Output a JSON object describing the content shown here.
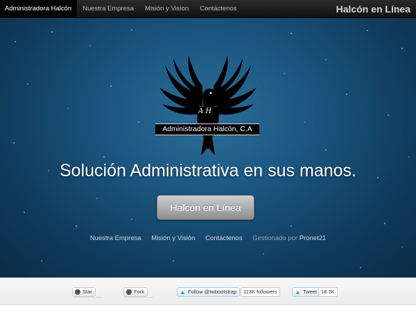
{
  "navbar": {
    "items": [
      {
        "label": "Administradora Halcón",
        "active": true
      },
      {
        "label": "Nuestra Empresa",
        "active": false
      },
      {
        "label": "Misión y Vision",
        "active": false
      },
      {
        "label": "Contáctenos",
        "active": false
      }
    ],
    "brand": "Halcón en Línea"
  },
  "hero": {
    "logo_text": "Administradora Halcón, C.A",
    "logo_initials": "A H",
    "headline": "Solución Administrativa en sus manos.",
    "cta_label": "Halcón en Línea",
    "links": [
      "Nuestra Empresa",
      "Misión y Visión",
      "Contáctenos"
    ],
    "credit_prefix": "Gestionado por",
    "credit_brand": "Pronet21"
  },
  "social": {
    "star_label": "Star",
    "fork_label": "Fork",
    "follow_label": "Follow @twbootstrap",
    "followers_count": "113K followers",
    "tweet_label": "Tweet",
    "tweet_count": "18.3K"
  },
  "colors": {
    "hero_bg": "#1b5680",
    "navbar_bg": "#1b1b1b",
    "twitter_blue": "#2ea0d8"
  }
}
